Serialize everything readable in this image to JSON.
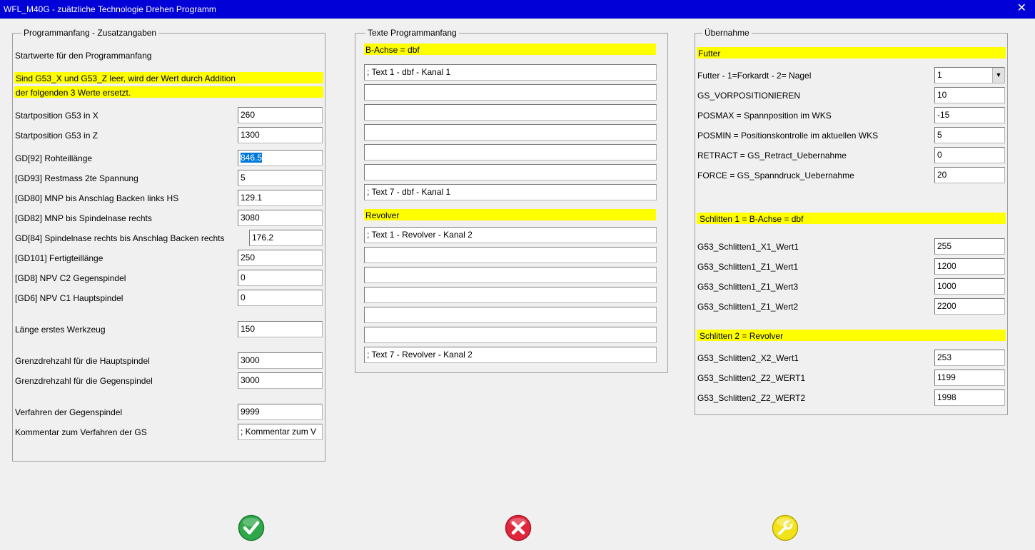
{
  "window": {
    "title": "WFL_M40G - zuätzliche Technologie Drehen Programm"
  },
  "left": {
    "legend": "Programmanfang - Zusatzangaben",
    "intro": "Startwerte für den Programmanfang",
    "note_line1": "Sind G53_X und G53_Z leer, wird der Wert durch Addition",
    "note_line2": "der folgenden 3 Werte ersetzt.",
    "fields": [
      {
        "label": "Startposition G53 in X",
        "value": "260"
      },
      {
        "label": "Startposition G53 in Z",
        "value": "1300"
      },
      {
        "label": "GD[92] Rohteillänge",
        "value": "846.5"
      },
      {
        "label": "[GD93] Restmass 2te Spannung",
        "value": "5"
      },
      {
        "label": "[GD80] MNP bis Anschlag Backen links HS",
        "value": "129.1"
      },
      {
        "label": "[GD82] MNP bis Spindelnase rechts",
        "value": "3080"
      },
      {
        "label": "GD[84] Spindelnase rechts bis Anschlag Backen rechts",
        "value": "176.2"
      },
      {
        "label": "[GD101] Fertigteillänge",
        "value": "250"
      },
      {
        "label": "[GD8] NPV C2 Gegenspindel",
        "value": "0"
      },
      {
        "label": "[GD6] NPV C1 Hauptspindel",
        "value": "0"
      },
      {
        "label": "Länge erstes Werkzeug",
        "value": "150"
      },
      {
        "label": "Grenzdrehzahl für die Hauptspindel",
        "value": "3000"
      },
      {
        "label": "Grenzdrehzahl für die Gegenspindel",
        "value": "3000"
      },
      {
        "label": "Verfahren der Gegenspindel",
        "value": "9999"
      },
      {
        "label": "Kommentar zum Verfahren der GS",
        "value": "; Kommentar zum V"
      }
    ]
  },
  "middle": {
    "legend": "Texte Programmanfang",
    "section1": "B-Achse = dbf",
    "texts1": [
      "; Text 1 - dbf - Kanal 1",
      "",
      "",
      "",
      "",
      "",
      "; Text 7 - dbf - Kanal 1"
    ],
    "section2": "Revolver",
    "texts2": [
      "; Text 1 - Revolver - Kanal 2",
      "",
      "",
      "",
      "",
      "",
      "; Text 7 - Revolver - Kanal 2"
    ]
  },
  "right": {
    "legend": "Übernahme",
    "section1": "Futter",
    "fields1": [
      {
        "label": "Futter - 1=Forkardt - 2= Nagel",
        "value": "1"
      },
      {
        "label": "GS_VORPOSITIONIEREN",
        "value": "10"
      },
      {
        "label": "POSMAX = Spannposition im WKS",
        "value": "-15"
      },
      {
        "label": "POSMIN = Positionskontrolle im aktuellen WKS",
        "value": "5"
      },
      {
        "label": "RETRACT = GS_Retract_Uebernahme",
        "value": "0"
      },
      {
        "label": "FORCE = GS_Spanndruck_Uebernahme",
        "value": "20"
      }
    ],
    "section2": "Schlitten 1 = B-Achse = dbf",
    "fields2": [
      {
        "label": "G53_Schlitten1_X1_Wert1",
        "value": "255"
      },
      {
        "label": "G53_Schlitten1_Z1_Wert1",
        "value": "1200"
      },
      {
        "label": "G53_Schlitten1_Z1_Wert3",
        "value": "1000"
      },
      {
        "label": "G53_Schlitten1_Z1_Wert2",
        "value": "2200"
      }
    ],
    "section3": "Schlitten 2 = Revolver",
    "fields3": [
      {
        "label": "G53_Schlitten2_X2_Wert1",
        "value": "253"
      },
      {
        "label": "G53_Schlitten2_Z2_WERT1",
        "value": "1199"
      },
      {
        "label": "G53_Schlitten2_Z2_WERT2",
        "value": "1998"
      }
    ]
  },
  "buttons": {
    "ok_icon": "checkmark-icon",
    "cancel_icon": "cross-icon",
    "tools_icon": "wrench-icon",
    "ok_color": "#2ea84a",
    "cancel_color": "#e0263d",
    "tools_color": "#f2e21a"
  }
}
